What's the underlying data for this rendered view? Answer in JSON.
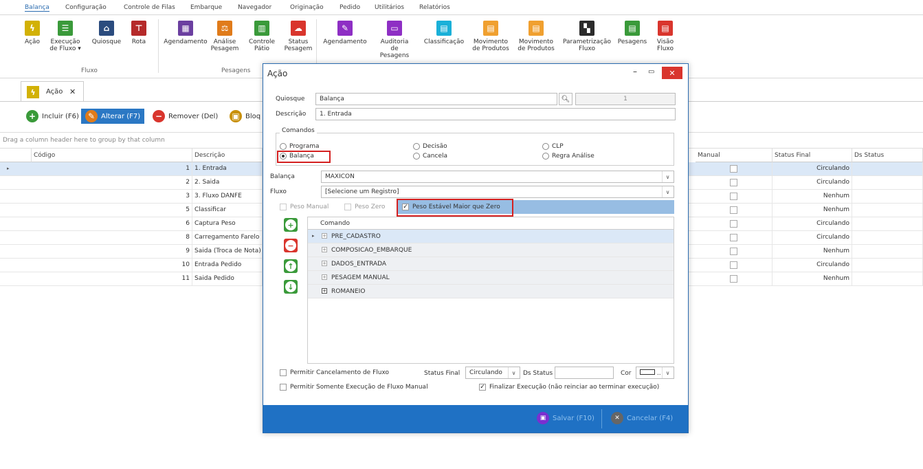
{
  "ribbon_tabs": [
    "Balança",
    "Configuração",
    "Controle de Filas",
    "Embarque",
    "Navegador",
    "Originação",
    "Pedido",
    "Utilitários",
    "Relatórios"
  ],
  "ribbon": {
    "fluxo_buttons": [
      {
        "label": "Ação",
        "icon": "lightning-icon",
        "color": "#d2b106"
      },
      {
        "label": "Execução\nde Fluxo ▾",
        "icon": "list-icon",
        "color": "#3a9a3a"
      },
      {
        "label": "Quiosque",
        "icon": "house-icon",
        "color": "#2b4c7e"
      },
      {
        "label": "Rota",
        "icon": "signpost-icon",
        "color": "#b52a2a"
      }
    ],
    "pesagens_buttons": [
      {
        "label": "Agendamento",
        "icon": "calendar-icon",
        "color": "#6b3fa0"
      },
      {
        "label": "Análise\nPesagem",
        "icon": "scale-icon",
        "color": "#e07b1a"
      },
      {
        "label": "Controle\nPátio",
        "icon": "bars-icon",
        "color": "#3a9a3a"
      },
      {
        "label": "Status\nPesagem",
        "icon": "cloud-icon",
        "color": "#d9352d"
      }
    ],
    "other_buttons": [
      {
        "label": "Agendamento",
        "icon": "edit-icon",
        "color": "#8e2fc4"
      },
      {
        "label": "Auditoria\nde Pesagens",
        "icon": "monitor-icon",
        "color": "#8e2fc4"
      },
      {
        "label": "Classificação",
        "icon": "document-icon",
        "color": "#1ab0d8"
      },
      {
        "label": "Movimento\nde Produtos",
        "icon": "document-icon",
        "color": "#f0a030"
      },
      {
        "label": "Movimento\nde Produtos",
        "icon": "document-icon",
        "color": "#f0a030"
      },
      {
        "label": "Parametrização\nFluxo",
        "icon": "grid-icon",
        "color": "#2b2b2b"
      },
      {
        "label": "Pesagens",
        "icon": "document-icon",
        "color": "#3a9a3a"
      },
      {
        "label": "Visão\nFluxo",
        "icon": "document-icon",
        "color": "#d9352d"
      }
    ],
    "group_fluxo": "Fluxo",
    "group_pesagens": "Pesagens"
  },
  "doc_tab": {
    "label": "Ação",
    "close": "✕"
  },
  "toolbar": {
    "incluir": "Incluir (F6)",
    "alterar": "Alterar (F7)",
    "remover": "Remover (Del)",
    "bloquear": "Bloq"
  },
  "grid": {
    "group_hint": "Drag a column header here to group by that column",
    "headers": {
      "codigo": "Código",
      "descricao": "Descrição",
      "manual": "Manual",
      "status_final": "Status Final",
      "ds_status": "Ds Status"
    },
    "rows": [
      {
        "codigo": "1",
        "descricao": "1. Entrada",
        "status": "Circulando"
      },
      {
        "codigo": "2",
        "descricao": "2. Saida",
        "status": "Circulando"
      },
      {
        "codigo": "3",
        "descricao": "3. Fluxo DANFE",
        "status": "Nenhum"
      },
      {
        "codigo": "5",
        "descricao": "Classificar",
        "status": "Nenhum"
      },
      {
        "codigo": "6",
        "descricao": "Captura Peso",
        "status": "Circulando"
      },
      {
        "codigo": "8",
        "descricao": "Carregamento Farelo",
        "status": "Circulando"
      },
      {
        "codigo": "9",
        "descricao": "Saida (Troca de Nota)",
        "status": "Nenhum"
      },
      {
        "codigo": "10",
        "descricao": "Entrada Pedido",
        "status": "Circulando"
      },
      {
        "codigo": "11",
        "descricao": "Saida Pedido",
        "status": "Nenhum"
      }
    ]
  },
  "dialog": {
    "title": "Ação",
    "quiosque_label": "Quiosque",
    "quiosque_value": "Balança",
    "quiosque_code": "1",
    "descricao_label": "Descrição",
    "descricao_value": "1. Entrada",
    "comandos_legend": "Comandos",
    "radios": {
      "programa": "Programa",
      "balanca": "Balança",
      "decisao": "Decisão",
      "cancela": "Cancela",
      "clp": "CLP",
      "regra": "Regra Análise"
    },
    "balanca_label": "Balança",
    "balanca_value": "MAXICON",
    "fluxo_label": "Fluxo",
    "fluxo_value": "[Selecione um Registro]",
    "peso_manual": "Peso Manual",
    "peso_zero": "Peso Zero",
    "peso_estavel": "Peso Estável Maior que Zero",
    "comando_header": "Comando",
    "comandos": [
      "PRE_CADASTRO",
      "COMPOSICAO_EMBARQUE",
      "DADOS_ENTRADA",
      "PESAGEM MANUAL",
      "ROMANEIO"
    ],
    "permitir_cancelamento": "Permitir Cancelamento de Fluxo",
    "status_final_label": "Status Final",
    "status_final_value": "Circulando",
    "ds_status_label": "Ds Status",
    "cor_label": "Cor",
    "permitir_somente": "Permitir Somente Execução de Fluxo Manual",
    "finalizar": "Finalizar Execução (não reinciar ao terminar execução)",
    "salvar": "Salvar (F10)",
    "cancelar": "Cancelar (F4)"
  }
}
